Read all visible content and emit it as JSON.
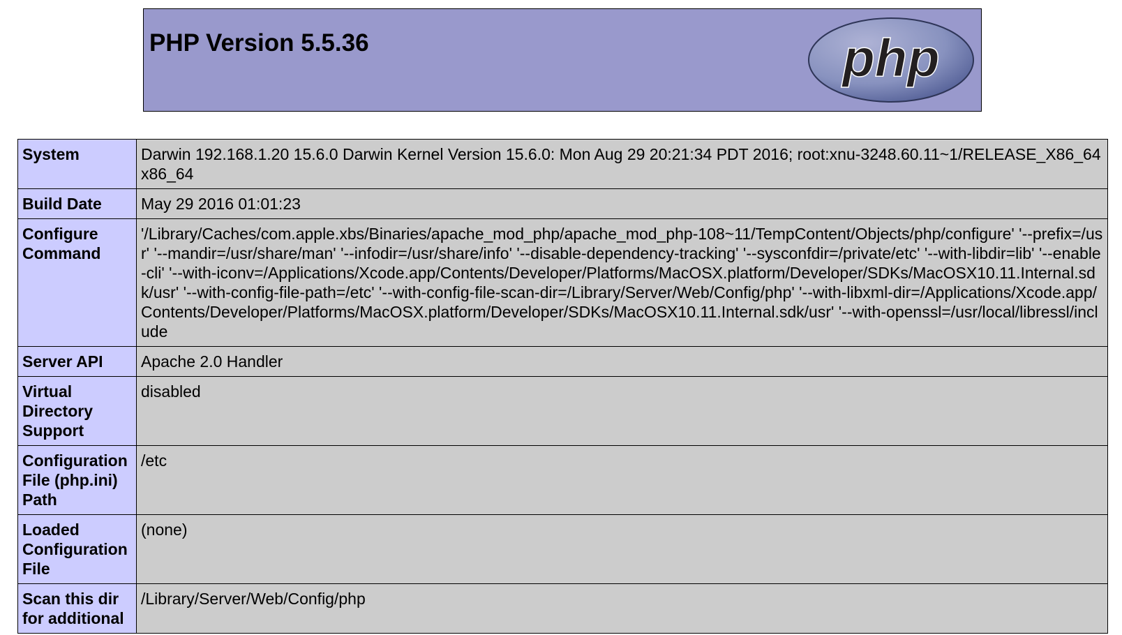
{
  "header": {
    "title": "PHP Version 5.5.36",
    "logo_text": "php"
  },
  "rows": [
    {
      "key": "System",
      "value": "Darwin 192.168.1.20 15.6.0 Darwin Kernel Version 15.6.0: Mon Aug 29 20:21:34 PDT 2016; root:xnu-3248.60.11~1/RELEASE_X86_64 x86_64"
    },
    {
      "key": "Build Date",
      "value": "May 29 2016 01:01:23"
    },
    {
      "key": "Configure Command",
      "value": "'/Library/Caches/com.apple.xbs/Binaries/apache_mod_php/apache_mod_php-108~11/TempContent/Objects/php/configure' '--prefix=/usr' '--mandir=/usr/share/man' '--infodir=/usr/share/info' '--disable-dependency-tracking' '--sysconfdir=/private/etc' '--with-libdir=lib' '--enable-cli' '--with-iconv=/Applications/Xcode.app/Contents/Developer/Platforms/MacOSX.platform/Developer/SDKs/MacOSX10.11.Internal.sdk/usr' '--with-config-file-path=/etc' '--with-config-file-scan-dir=/Library/Server/Web/Config/php' '--with-libxml-dir=/Applications/Xcode.app/Contents/Developer/Platforms/MacOSX.platform/Developer/SDKs/MacOSX10.11.Internal.sdk/usr' '--with-openssl=/usr/local/libressl/include"
    },
    {
      "key": "Server API",
      "value": "Apache 2.0 Handler"
    },
    {
      "key": "Virtual Directory Support",
      "value": "disabled"
    },
    {
      "key": "Configuration File (php.ini) Path",
      "value": "/etc"
    },
    {
      "key": "Loaded Configuration File",
      "value": "(none)"
    },
    {
      "key": "Scan this dir for additional",
      "value": "/Library/Server/Web/Config/php"
    }
  ],
  "colors": {
    "header_bg": "#9999cc",
    "key_bg": "#ccccff",
    "value_bg": "#cccccc",
    "logo_oval": "#8892bf",
    "logo_text": "#231f20"
  },
  "icons": {
    "logo": "php-logo-icon"
  }
}
